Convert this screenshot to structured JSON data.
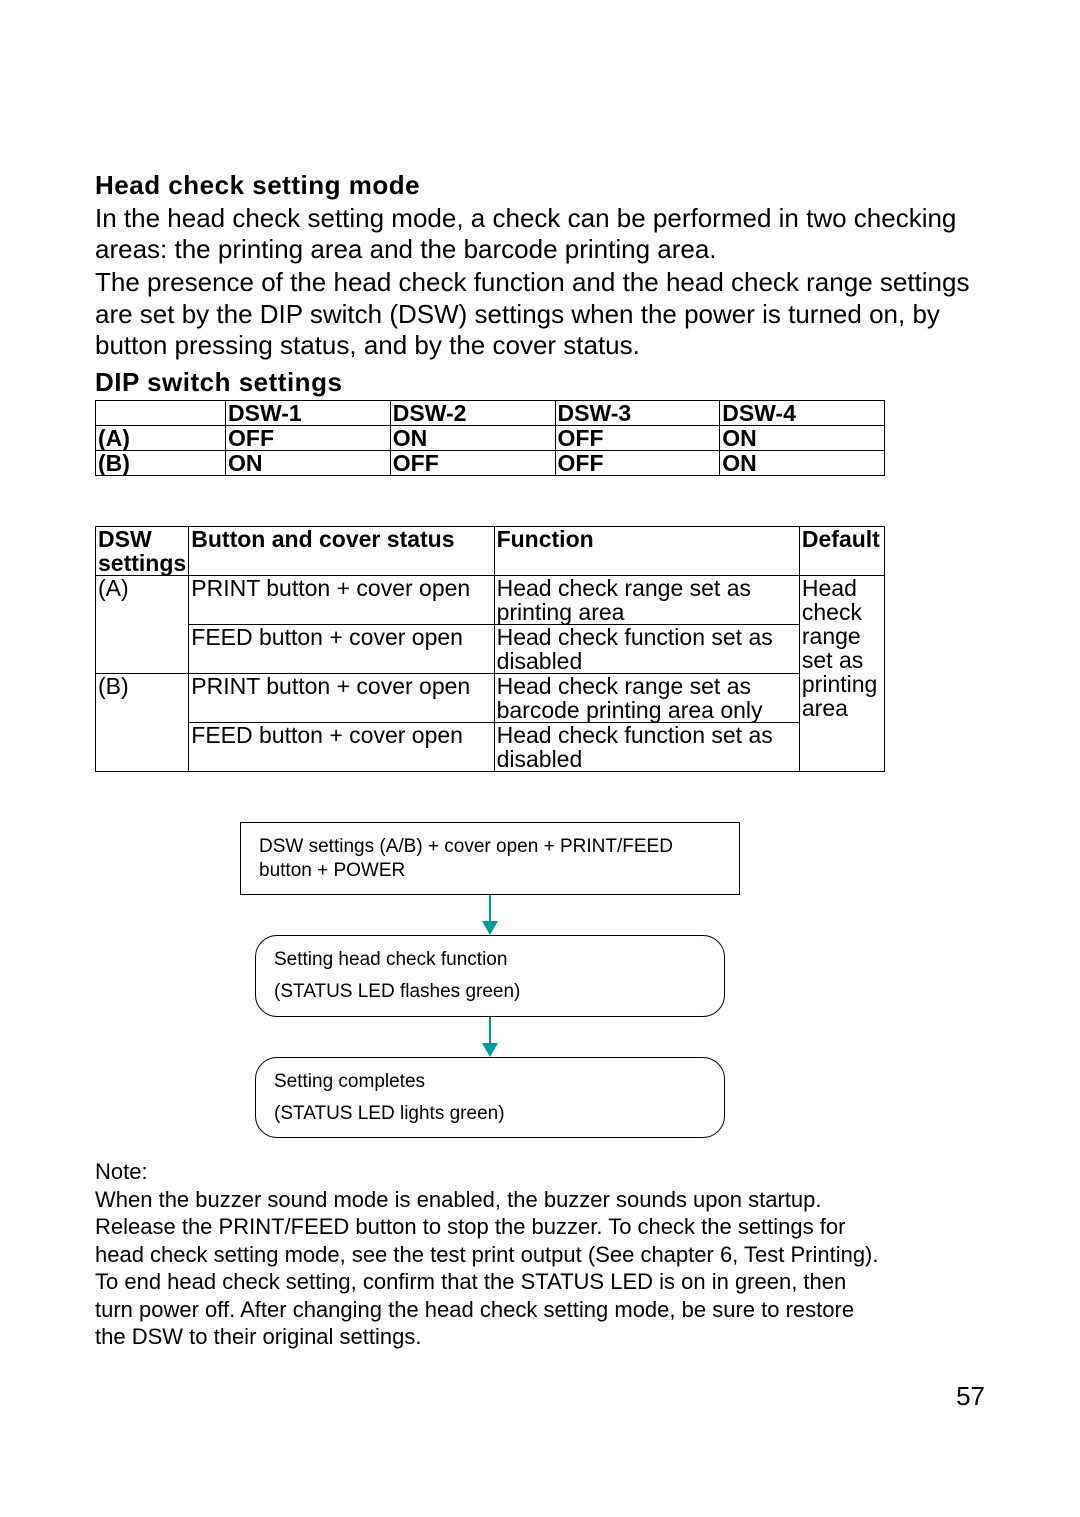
{
  "section1": {
    "heading": "Head check setting mode",
    "p1": "In the head check setting mode, a check can be performed in two checking areas: the printing area and the barcode printing area.",
    "p2": "The presence of the head check function and the head check range settings are set by the DIP switch (DSW) settings when the power is turned on, by button pressing status, and by the cover status."
  },
  "section2": {
    "heading": "DIP switch settings"
  },
  "dip_table": {
    "headers": [
      "",
      "DSW-1",
      "DSW-2",
      "DSW-3",
      "DSW-4"
    ],
    "rows": [
      {
        "label": "(A)",
        "cells": [
          "OFF",
          "ON",
          "OFF",
          "ON"
        ]
      },
      {
        "label": "(B)",
        "cells": [
          "ON",
          "OFF",
          "OFF",
          "ON"
        ]
      }
    ]
  },
  "func_table": {
    "headers": {
      "c1": "DSW settings",
      "c2": "Button and cover status",
      "c3": "Function",
      "c4": "Default"
    },
    "groups": [
      {
        "label": "(A)",
        "rows": [
          {
            "button": "PRINT button + cover open",
            "function": "Head check range set as printing area"
          },
          {
            "button": "FEED button + cover open",
            "function": "Head check function set as disabled"
          }
        ]
      },
      {
        "label": "(B)",
        "rows": [
          {
            "button": "PRINT button + cover open",
            "function": "Head check range set as barcode printing area only"
          },
          {
            "button": "FEED button + cover open",
            "function": "Head check function set as disabled"
          }
        ]
      }
    ],
    "default": "Head check range set as printing area"
  },
  "flow": {
    "step1": "DSW settings (A/B) + cover open + PRINT/FEED button + POWER",
    "step2_line1": "Setting head check function",
    "step2_line2": "(STATUS LED flashes green)",
    "step3_line1": "Setting completes",
    "step3_line2": "(STATUS LED lights green)"
  },
  "note": {
    "label": "Note:",
    "p1": "When the buzzer sound mode is enabled, the buzzer sounds upon startup. Release the PRINT/FEED button to stop the buzzer. To check the settings for head check setting mode, see the test print output (See chapter 6, Test Printing).",
    "p2": "To end head check setting, confirm that the STATUS LED is on in green, then turn power off. After changing the head check setting mode, be sure to restore the DSW to their original settings."
  },
  "page_number": "57"
}
